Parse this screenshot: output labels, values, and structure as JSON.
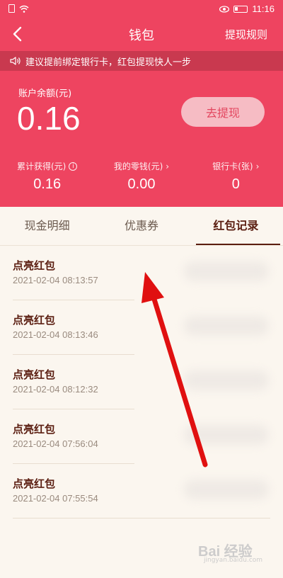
{
  "status_bar": {
    "time": "11:16"
  },
  "nav": {
    "title": "钱包",
    "right_action": "提现规则"
  },
  "notice": {
    "text": "建议提前绑定银行卡，红包提现快人一步"
  },
  "balance": {
    "label": "账户余额(元)",
    "value": "0.16",
    "withdraw_label": "去提现"
  },
  "stats": [
    {
      "label": "累计获得(元)",
      "value": "0.16",
      "icon": "info-icon"
    },
    {
      "label": "我的零钱(元)",
      "value": "0.00",
      "icon": "chevron-right-icon"
    },
    {
      "label": "银行卡(张)",
      "value": "0",
      "icon": "chevron-right-icon"
    }
  ],
  "tabs": [
    {
      "label": "现金明细"
    },
    {
      "label": "优惠券"
    },
    {
      "label": "红包记录",
      "active": true
    }
  ],
  "records": [
    {
      "title": "点亮红包",
      "time": "2021-02-04 08:13:57"
    },
    {
      "title": "点亮红包",
      "time": "2021-02-04 08:13:46"
    },
    {
      "title": "点亮红包",
      "time": "2021-02-04 08:12:32"
    },
    {
      "title": "点亮红包",
      "time": "2021-02-04 07:56:04"
    },
    {
      "title": "点亮红包",
      "time": "2021-02-04 07:55:54"
    }
  ],
  "watermark": {
    "text": "Bai 经验",
    "sub": "jingyan.baidu.com"
  },
  "colors": {
    "brand_red": "#ee4460",
    "notice_bg": "#c9394f",
    "list_bg": "#fbf6ef",
    "annotation_arrow": "#e01010"
  }
}
